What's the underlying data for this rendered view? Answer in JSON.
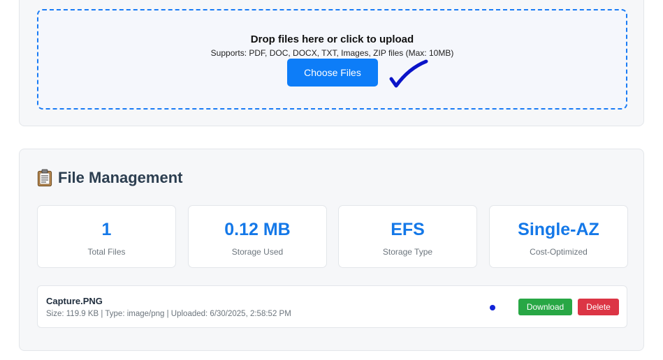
{
  "upload": {
    "title": "Drop files here or click to upload",
    "subtitle": "Supports: PDF, DOC, DOCX, TXT, Images, ZIP files (Max: 10MB)",
    "button_label": "Choose Files"
  },
  "management": {
    "title": "File Management",
    "stats": [
      {
        "value": "1",
        "label": "Total Files"
      },
      {
        "value": "0.12 MB",
        "label": "Storage Used"
      },
      {
        "value": "EFS",
        "label": "Storage Type"
      },
      {
        "value": "Single-AZ",
        "label": "Cost-Optimized"
      }
    ],
    "files": [
      {
        "name": "Capture.PNG",
        "meta": "Size: 119.9 KB | Type: image/png | Uploaded: 6/30/2025, 2:58:52 PM",
        "download_label": "Download",
        "delete_label": "Delete"
      }
    ]
  },
  "colors": {
    "accent": "#0d7df8",
    "stat_value": "#1478e8",
    "download": "#28a745",
    "delete": "#dc3545",
    "checkmark": "#0a14c8"
  },
  "icons": {
    "section": "clipboard-icon",
    "annotation": "checkmark-icon",
    "status": "status-dot-icon"
  }
}
